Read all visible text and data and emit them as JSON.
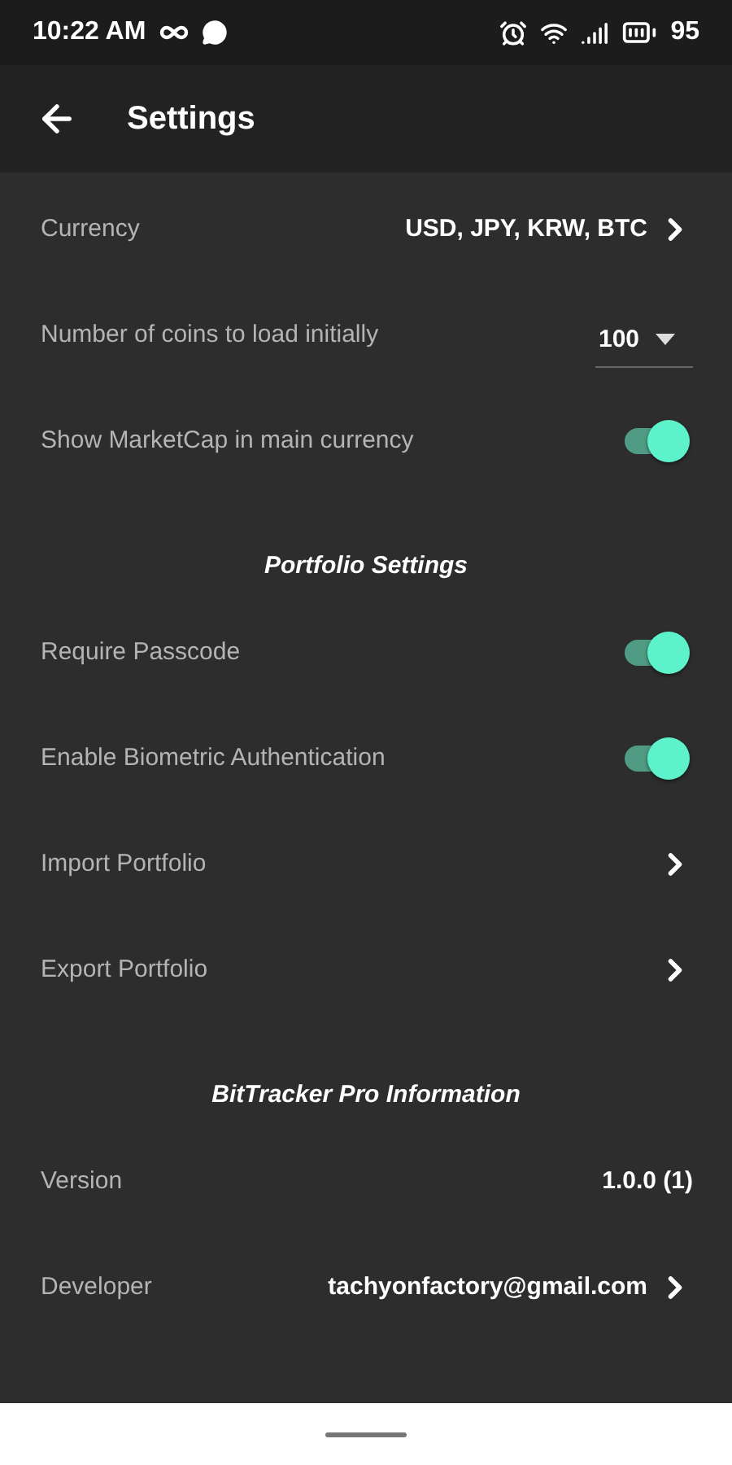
{
  "status_bar": {
    "time": "10:22 AM",
    "battery": "95"
  },
  "app_bar": {
    "title": "Settings"
  },
  "rows": [
    {
      "kind": "link",
      "label": "Currency",
      "value": "USD, JPY, KRW, BTC"
    },
    {
      "kind": "dropdown",
      "label": "Number of coins to load initially",
      "value": "100"
    },
    {
      "kind": "toggle",
      "label": "Show MarketCap in main currency",
      "on": true
    },
    {
      "kind": "header",
      "label": "Portfolio Settings"
    },
    {
      "kind": "toggle",
      "label": "Require Passcode",
      "on": true
    },
    {
      "kind": "toggle",
      "label": "Enable Biometric Authentication",
      "on": true
    },
    {
      "kind": "link",
      "label": "Import Portfolio"
    },
    {
      "kind": "link",
      "label": "Export Portfolio"
    },
    {
      "kind": "header",
      "label": "BitTracker Pro Information"
    },
    {
      "kind": "text",
      "label": "Version",
      "value": "1.0.0 (1)"
    },
    {
      "kind": "link",
      "label": "Developer",
      "value": "tachyonfactory@gmail.com"
    }
  ]
}
